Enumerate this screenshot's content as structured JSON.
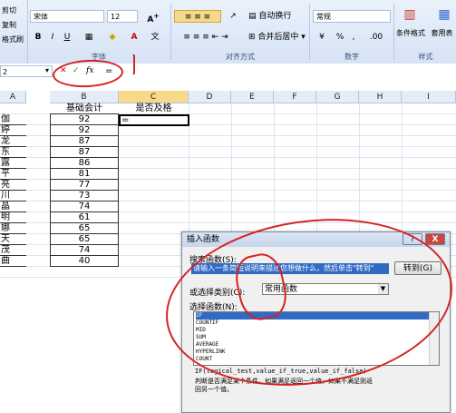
{
  "ribbon": {
    "clipboard": {
      "cut": "剪切",
      "copy": "复制",
      "format_painter": "格式刷"
    },
    "font": {
      "name": "宋体",
      "size": "12",
      "group_label": "字体",
      "bold": "B",
      "italic": "I",
      "underline": "U",
      "font_color": "A"
    },
    "alignment": {
      "wrap_text": "自动换行",
      "merge_center": "合并后居中",
      "group_label": "对齐方式"
    },
    "number": {
      "format": "常规",
      "percent": "%",
      "comma": ",",
      "group_label": "数字"
    },
    "styles": {
      "conditional": "条件格式",
      "table_format": "套用表格格式",
      "group_label": "样式"
    }
  },
  "formula_bar": {
    "name_box": "2",
    "fx": "fx",
    "content": "="
  },
  "columns": [
    "A",
    "B",
    "C",
    "D",
    "E",
    "F",
    "G",
    "H",
    "I"
  ],
  "sheet": {
    "header_b": "基础会计",
    "header_c": "是否及格",
    "c1_value": "=",
    "names": [
      "伽",
      "婷",
      "龙",
      "东",
      "露",
      "平",
      "亮",
      "川",
      "晶",
      "明",
      "娜",
      "天",
      "茂",
      "曲"
    ],
    "scores": [
      "92",
      "92",
      "87",
      "87",
      "86",
      "81",
      "77",
      "73",
      "74",
      "61",
      "65",
      "65",
      "74",
      "40"
    ]
  },
  "dialog": {
    "title": "插入函数",
    "search_label": "搜索函数(S):",
    "search_placeholder": "请输入一条简短说明来描述您想做什么，然后单击\"转到\"",
    "go_button": "转到(G)",
    "category_label": "或选择类别(C):",
    "category_value": "常用函数",
    "select_label": "选择函数(N):",
    "functions": [
      "IF",
      "COUNTIF",
      "MID",
      "SUM",
      "AVERAGE",
      "HYPERLINK",
      "COUNT"
    ],
    "syntax": "IF(logical_test,value_if_true,value_if_false)",
    "description": "判断是否满足某个条件，如果满足返回一个值，如果不满足则返回另一个值。",
    "help_btn": "?",
    "close_btn": "X"
  },
  "accent": {
    "annotation": "#d62222",
    "selection": "#316ac5"
  }
}
